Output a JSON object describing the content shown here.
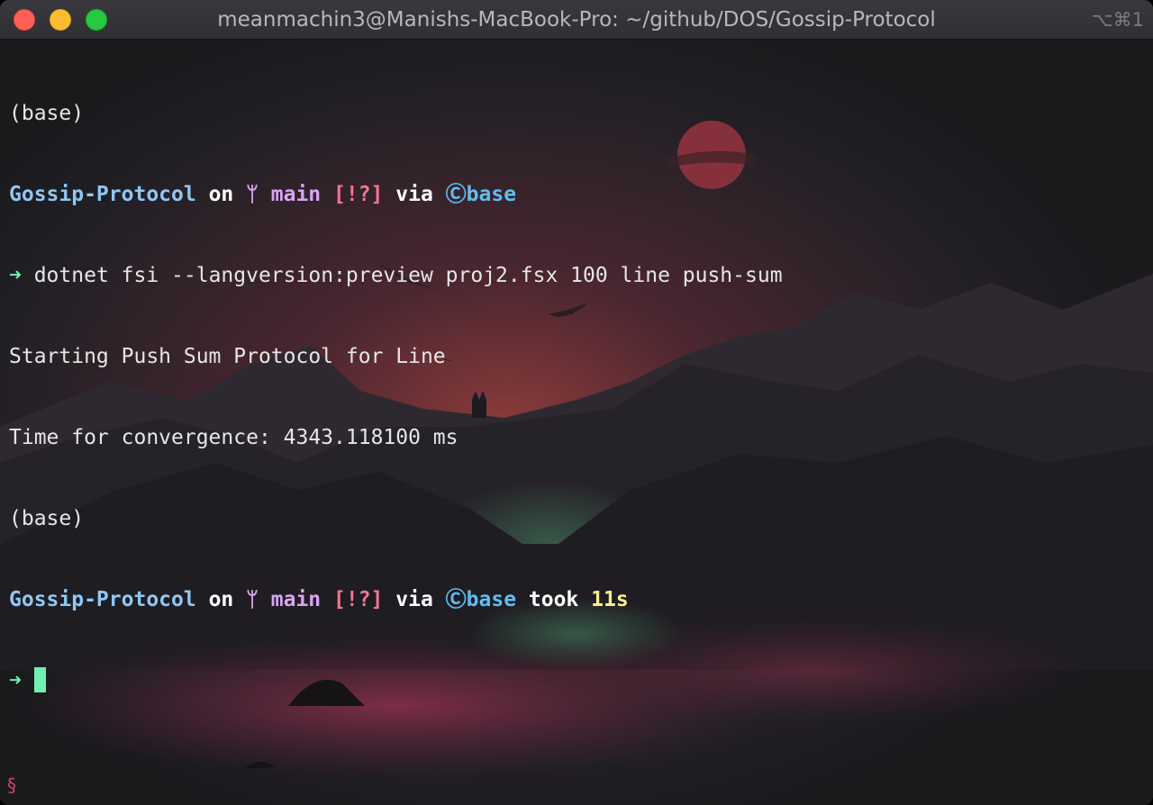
{
  "window": {
    "title": "meanmachin3@Manishs-MacBook-Pro: ~/github/DOS/Gossip-Protocol",
    "shortcut": "⌥⌘1"
  },
  "terminal": {
    "line1": {
      "text": "(base)"
    },
    "prompt1": {
      "dir": "Gossip-Protocol",
      "on": " on ",
      "branch_icon": "ᛘ",
      "branch": " main ",
      "status": "[!?]",
      "via": " via ",
      "conda_icon": "Ⓒ",
      "env": "base"
    },
    "command": {
      "arrow": "➜",
      "text": " dotnet fsi --langversion:preview proj2.fsx 100 line push-sum"
    },
    "output1": "Starting Push Sum Protocol for Line",
    "output2": "Time for convergence: 4343.118100 ms",
    "line6": {
      "text": "(base)"
    },
    "prompt2": {
      "dir": "Gossip-Protocol",
      "on": " on ",
      "branch_icon": "ᛘ",
      "branch": " main ",
      "status": "[!?]",
      "via": " via ",
      "conda_icon": "Ⓒ",
      "env": "base",
      "took": " took ",
      "duration": "11s"
    },
    "input": {
      "arrow": "➜"
    }
  },
  "corner_icon": "§",
  "colors": {
    "dir": "#8fc7f5",
    "branch": "#d9a3f5",
    "status": "#f07891",
    "conda": "#5fbef5",
    "duration": "#fbf08c",
    "arrow": "#6ef0b0"
  }
}
